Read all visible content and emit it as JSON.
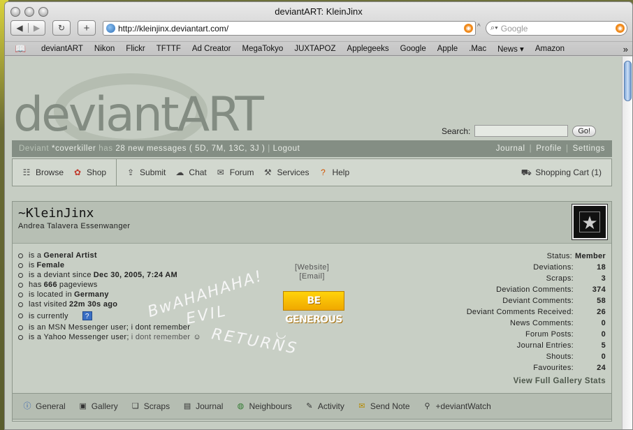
{
  "window": {
    "title": "deviantART: KleinJinx"
  },
  "toolbar": {
    "back_glyph": "◀",
    "forward_glyph": "▶",
    "reload_glyph": "↻",
    "addtab_glyph": "+",
    "url": "http://kleinjinx.deviantart.com/",
    "search_placeholder": "Google"
  },
  "bookmarks": [
    "deviantART",
    "Nikon",
    "Flickr",
    "TFTTF",
    "Ad Creator",
    "MegaTokyo",
    "JUXTAPOZ",
    "Applegeeks",
    "Google",
    "Apple",
    ".Mac",
    "News ▾",
    "Amazon"
  ],
  "site": {
    "logo": "deviantART",
    "search_label": "Search:",
    "search_value": "",
    "go_label": "Go!"
  },
  "userbar": {
    "prefix": "Deviant",
    "username": "*coverkiller",
    "has": "has",
    "messages": "28 new messages",
    "breakdown": "( 5D, 7M, 13C, 3J )",
    "sep": "|",
    "logout": "Logout",
    "links": [
      "Journal",
      "Profile",
      "Settings"
    ]
  },
  "nav": {
    "left": [
      {
        "label": "Browse",
        "icon": "browse-icon"
      },
      {
        "label": "Shop",
        "icon": "shop-icon"
      }
    ],
    "right": [
      {
        "label": "Submit",
        "icon": "submit-icon"
      },
      {
        "label": "Chat",
        "icon": "chat-icon"
      },
      {
        "label": "Forum",
        "icon": "forum-icon"
      },
      {
        "label": "Services",
        "icon": "services-icon"
      },
      {
        "label": "Help",
        "icon": "help-icon"
      }
    ],
    "cart": "Shopping Cart (1)"
  },
  "profile": {
    "name": "~KleinJinx",
    "real_name": "Andrea Talavera Essenwanger",
    "facts": {
      "artist_pre": "is a",
      "artist": "General Artist",
      "gender_pre": "is",
      "gender": "Female",
      "since_pre": "is a deviant since",
      "since": "Dec 30, 2005, 7:24 AM",
      "views_pre": "has",
      "views": "666",
      "views_post": "pageviews",
      "location_pre": "is located in",
      "location": "Germany",
      "visited_pre": "last visited",
      "visited": "22m 30s ago",
      "currently": "is currently",
      "msn": "is an MSN Messenger user; i dont remember",
      "yahoo_pre": "is a Yahoo Messenger user;",
      "yahoo": "i dont remember"
    },
    "links": {
      "website": "[Website]",
      "email": "[Email]"
    },
    "banner": "BE GENEROUS",
    "scrawl": [
      "BwAHAHAHA!",
      "EVIL",
      "RETURNS"
    ],
    "stats": {
      "status_label": "Status:",
      "status": "Member",
      "rows": [
        {
          "label": "Deviations:",
          "value": "18"
        },
        {
          "label": "Scraps:",
          "value": "3"
        },
        {
          "label": "Deviation Comments:",
          "value": "374"
        },
        {
          "label": "Deviant Comments:",
          "value": "58"
        },
        {
          "label": "Deviant Comments Received:",
          "value": "26"
        },
        {
          "label": "News Comments:",
          "value": "0"
        },
        {
          "label": "Forum Posts:",
          "value": "0"
        },
        {
          "label": "Journal Entries:",
          "value": "5"
        },
        {
          "label": "Shouts:",
          "value": "0"
        },
        {
          "label": "Favourites:",
          "value": "24"
        }
      ],
      "full_link": "View Full Gallery Stats"
    }
  },
  "tabs": [
    {
      "label": "General",
      "icon": "info-icon"
    },
    {
      "label": "Gallery",
      "icon": "gallery-icon"
    },
    {
      "label": "Scraps",
      "icon": "scraps-icon"
    },
    {
      "label": "Journal",
      "icon": "journal-icon"
    },
    {
      "label": "Neighbours",
      "icon": "globe-icon"
    },
    {
      "label": "Activity",
      "icon": "activity-icon"
    },
    {
      "label": "Send Note",
      "icon": "note-icon"
    },
    {
      "label": "+deviantWatch",
      "icon": "watch-icon"
    }
  ]
}
